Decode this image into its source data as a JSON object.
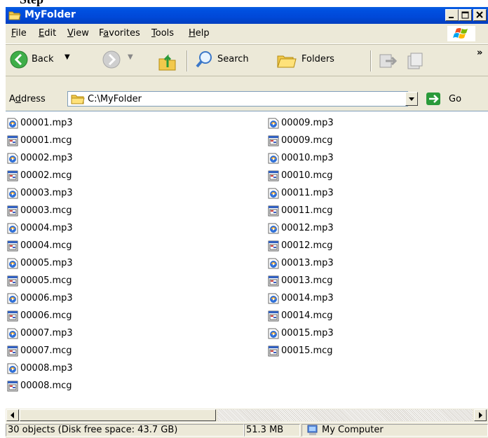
{
  "top_crop_text": "Step",
  "window": {
    "title": "MyFolder"
  },
  "menu": [
    {
      "label": "File",
      "accel": "F"
    },
    {
      "label": "Edit",
      "accel": "E"
    },
    {
      "label": "View",
      "accel": "V"
    },
    {
      "label": "Favorites",
      "accel": "a"
    },
    {
      "label": "Tools",
      "accel": "T"
    },
    {
      "label": "Help",
      "accel": "H"
    }
  ],
  "toolbar": {
    "back_label": "Back",
    "search_label": "Search",
    "folders_label": "Folders",
    "chevron": "»"
  },
  "address": {
    "label": "Address",
    "value": "C:\\MyFolder",
    "go_label": "Go"
  },
  "files_col1": [
    {
      "name": "00001.mp3",
      "type": "mp3"
    },
    {
      "name": "00001.mcg",
      "type": "mcg"
    },
    {
      "name": "00002.mp3",
      "type": "mp3"
    },
    {
      "name": "00002.mcg",
      "type": "mcg"
    },
    {
      "name": "00003.mp3",
      "type": "mp3"
    },
    {
      "name": "00003.mcg",
      "type": "mcg"
    },
    {
      "name": "00004.mp3",
      "type": "mp3"
    },
    {
      "name": "00004.mcg",
      "type": "mcg"
    },
    {
      "name": "00005.mp3",
      "type": "mp3"
    },
    {
      "name": "00005.mcg",
      "type": "mcg"
    },
    {
      "name": "00006.mp3",
      "type": "mp3"
    },
    {
      "name": "00006.mcg",
      "type": "mcg"
    },
    {
      "name": "00007.mp3",
      "type": "mp3"
    },
    {
      "name": "00007.mcg",
      "type": "mcg"
    },
    {
      "name": "00008.mp3",
      "type": "mp3"
    },
    {
      "name": "00008.mcg",
      "type": "mcg"
    }
  ],
  "files_col2": [
    {
      "name": "00009.mp3",
      "type": "mp3"
    },
    {
      "name": "00009.mcg",
      "type": "mcg"
    },
    {
      "name": "00010.mp3",
      "type": "mp3"
    },
    {
      "name": "00010.mcg",
      "type": "mcg"
    },
    {
      "name": "00011.mp3",
      "type": "mp3"
    },
    {
      "name": "00011.mcg",
      "type": "mcg"
    },
    {
      "name": "00012.mp3",
      "type": "mp3"
    },
    {
      "name": "00012.mcg",
      "type": "mcg"
    },
    {
      "name": "00013.mp3",
      "type": "mp3"
    },
    {
      "name": "00013.mcg",
      "type": "mcg"
    },
    {
      "name": "00014.mp3",
      "type": "mp3"
    },
    {
      "name": "00014.mcg",
      "type": "mcg"
    },
    {
      "name": "00015.mp3",
      "type": "mp3"
    },
    {
      "name": "00015.mcg",
      "type": "mcg"
    }
  ],
  "status": {
    "objects": "30 objects (Disk free space: 43.7 GB)",
    "size": "51.3 MB",
    "location": "My Computer"
  },
  "colors": {
    "titlebar": "#0050e0",
    "chrome": "#ece9d8",
    "go_green": "#2a9a3a"
  },
  "icons": {
    "mp3": "media-player-file-icon",
    "mcg": "mcg-file-icon",
    "folder": "folder-icon"
  }
}
